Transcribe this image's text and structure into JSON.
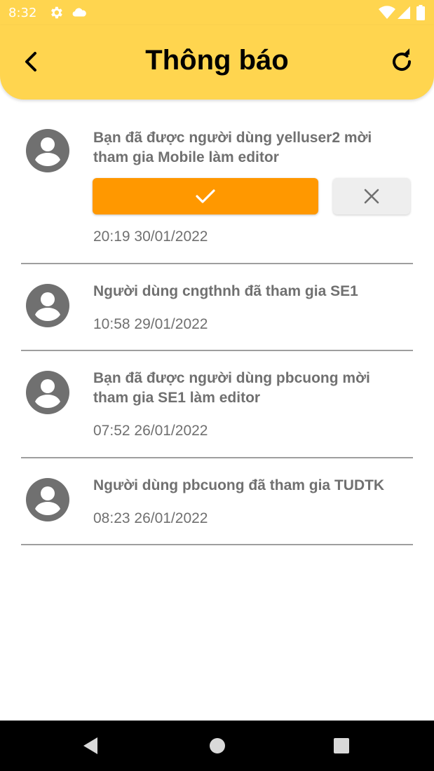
{
  "status_bar": {
    "time": "8:32",
    "icons": [
      "gear-icon",
      "cloud-icon",
      "wifi-icon",
      "signal-icon",
      "battery-icon"
    ]
  },
  "header": {
    "title": "Thông báo",
    "back_icon": "chevron-left-icon",
    "refresh_icon": "refresh-icon",
    "background_color": "#FFD54F"
  },
  "notifications": [
    {
      "message": "Bạn đã được người dùng yelluser2 mời tham gia Mobile làm editor",
      "time": "20:19  30/01/2022",
      "actions": {
        "accept_icon": "check-icon",
        "decline_icon": "close-icon"
      }
    },
    {
      "message": "Người dùng cngthnh đã tham gia SE1",
      "time": "10:58  29/01/2022"
    },
    {
      "message": "Bạn đã được người dùng pbcuong mời tham gia SE1 làm editor",
      "time": "07:52  26/01/2022"
    },
    {
      "message": "Người dùng pbcuong đã tham gia TUDTK",
      "time": "08:23  26/01/2022"
    }
  ],
  "colors": {
    "accent": "#FF9800",
    "text": "#707070",
    "divider": "#9e9e9e"
  },
  "nav_bar": {
    "icons": [
      "back-triangle-icon",
      "home-circle-icon",
      "recents-square-icon"
    ]
  }
}
